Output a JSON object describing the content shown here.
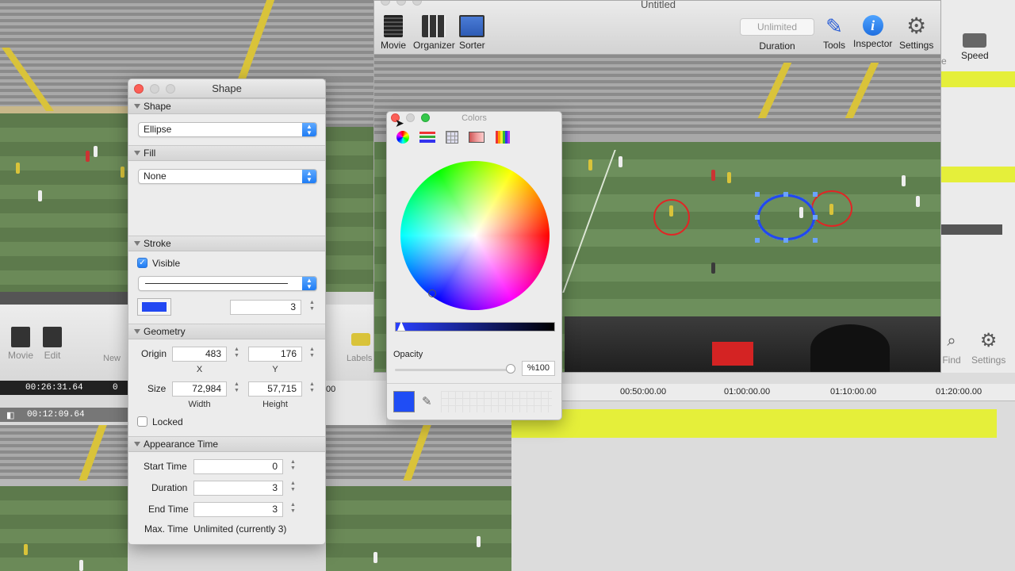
{
  "shape_panel": {
    "title": "Shape",
    "sections": {
      "shape": "Shape",
      "fill": "Fill",
      "stroke": "Stroke",
      "geometry": "Geometry",
      "appearance": "Appearance Time"
    },
    "shape_type": "Ellipse",
    "fill_type": "None",
    "stroke_visible_label": "Visible",
    "stroke_visible": true,
    "stroke_color": "#2147f2",
    "stroke_width": "3",
    "origin_label": "Origin",
    "origin_x": "483",
    "origin_y": "176",
    "x_label": "X",
    "y_label": "Y",
    "size_label": "Size",
    "width": "72,984",
    "height": "57,715",
    "width_label": "Width",
    "height_label": "Height",
    "locked_label": "Locked",
    "locked": false,
    "start_time_label": "Start Time",
    "start_time": "0",
    "duration_label": "Duration",
    "duration": "3",
    "end_time_label": "End Time",
    "end_time": "3",
    "max_time_label": "Max. Time",
    "max_time_value": "Unlimited (currently 3)"
  },
  "main_window": {
    "title": "Untitled",
    "toolbar": {
      "movie": "Movie",
      "organizer": "Organizer",
      "sorter": "Sorter",
      "duration_field": "Unlimited",
      "duration": "Duration",
      "tools": "Tools",
      "inspector": "Inspector",
      "settings": "Settings"
    }
  },
  "colors_panel": {
    "title": "Colors",
    "opacity_label": "Opacity",
    "opacity_value": "%100",
    "selected_color": "#1f4df5"
  },
  "background_app": {
    "toolbar": {
      "movie": "Movie",
      "edit": "Edit",
      "new": "New",
      "labels": "Labels",
      "find": "Find",
      "settings": "Settings",
      "speed": "Speed",
      "speed_partial": "e"
    },
    "timecode_1": "00:26:31.64",
    "timecode_2": "00:12:09.64",
    "timeline_zero": "0",
    "timeline_00": "00",
    "timeline_labels": [
      "00:50:00.00",
      "01:00:00.00",
      "01:10:00.00",
      "01:20:00.00"
    ]
  },
  "colors": {
    "yellow_track": "#e5ef3a",
    "close_red": "#fc5f57"
  }
}
